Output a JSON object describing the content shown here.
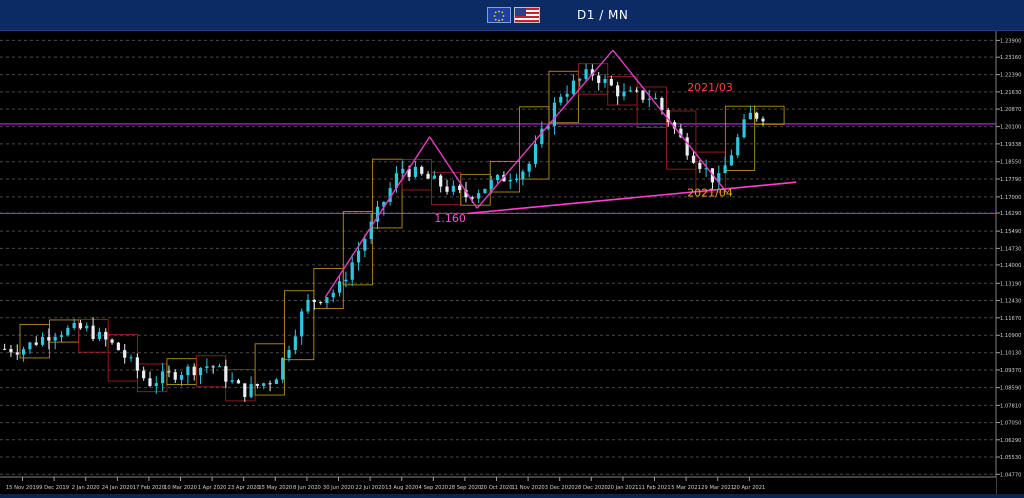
{
  "title": "D1 / MN",
  "colors": {
    "background": "#000000",
    "header": "#0c2a63",
    "bull_candle": "#2fc6e0",
    "bear_candle": "#e8eef2",
    "pattern_line": "#e040c0",
    "trend_line": "#ff3fd0",
    "monthly_box_up": "#c8a020",
    "monthly_box_down": "#b02020",
    "level_purple": "#a030c0",
    "label_red": "#ff4040",
    "label_orange": "#f0a020",
    "label_pink": "#ff50d0"
  },
  "icons": [
    "eu-flag-icon",
    "us-flag-icon"
  ],
  "chart_data": {
    "type": "candlestick",
    "symbol": "EUR/USD",
    "timeframe": "D1 / MN",
    "x_tick_labels": [
      "15 Nov 2019",
      "9 Dec 2019",
      "2 Jan 2020",
      "24 Jan 2020",
      "17 Feb 2020",
      "10 Mar 2020",
      "1 Apr 2020",
      "23 Apr 2020",
      "15 May 2020",
      "8 Jun 2020",
      "30 Jun 2020",
      "22 Jul 2020",
      "13 Aug 2020",
      "4 Sep 2020",
      "28 Sep 2020",
      "20 Oct 2020",
      "11 Nov 2020",
      "3 Dec 2020",
      "28 Dec 2020",
      "20 Jan 2021",
      "11 Feb 2021",
      "5 Mar 2021",
      "29 Mar 2021",
      "20 Apr 2021"
    ],
    "y_tick_labels": [
      "1.23900",
      "1.23160",
      "1.22390",
      "1.21630",
      "1.20870",
      "1.20100",
      "1.19338",
      "1.18550",
      "1.17790",
      "1.17000",
      "1.16290",
      "1.15490",
      "1.14730",
      "1.14000",
      "1.13190",
      "1.12430",
      "1.11670",
      "1.10900",
      "1.10130",
      "1.09370",
      "1.08590",
      "1.07810",
      "1.07050",
      "1.06290",
      "1.05530",
      "1.04770"
    ],
    "ylim": [
      1.0465,
      1.2405
    ],
    "annotations": [
      {
        "text": "2021/03",
        "price": 1.2168,
        "date_index": 22
      },
      {
        "text": "2021/04",
        "price": 1.1702,
        "date_index": 22
      },
      {
        "text": "1.160",
        "price": 1.159,
        "date_index": 14
      }
    ],
    "pattern_zigzag": [
      {
        "date_index": 9.6,
        "price": 1.1258
      },
      {
        "date_index": 12.9,
        "price": 1.1965
      },
      {
        "date_index": 14.4,
        "price": 1.165
      },
      {
        "date_index": 18.7,
        "price": 1.2347
      },
      {
        "date_index": 22.3,
        "price": 1.172
      }
    ],
    "trendline": [
      {
        "date_index": 14.1,
        "price": 1.1627
      },
      {
        "date_index": 24.5,
        "price": 1.1765
      }
    ],
    "horizontal_levels": [
      1.2022,
      1.1627
    ],
    "series": [
      {
        "name": "",
        "x": [
          0,
          1,
          2,
          3,
          4,
          5,
          6,
          7,
          8,
          9,
          10,
          11,
          12,
          13,
          14,
          15,
          16,
          17,
          18,
          19,
          20,
          21,
          22,
          23
        ],
        "close": [
          1.103,
          1.1105,
          1.112,
          1.1035,
          1.088,
          1.093,
          1.096,
          1.084,
          1.09,
          1.123,
          1.129,
          1.156,
          1.183,
          1.177,
          1.17,
          1.177,
          1.183,
          1.215,
          1.225,
          1.215,
          1.214,
          1.192,
          1.176,
          1.206
        ]
      }
    ]
  }
}
